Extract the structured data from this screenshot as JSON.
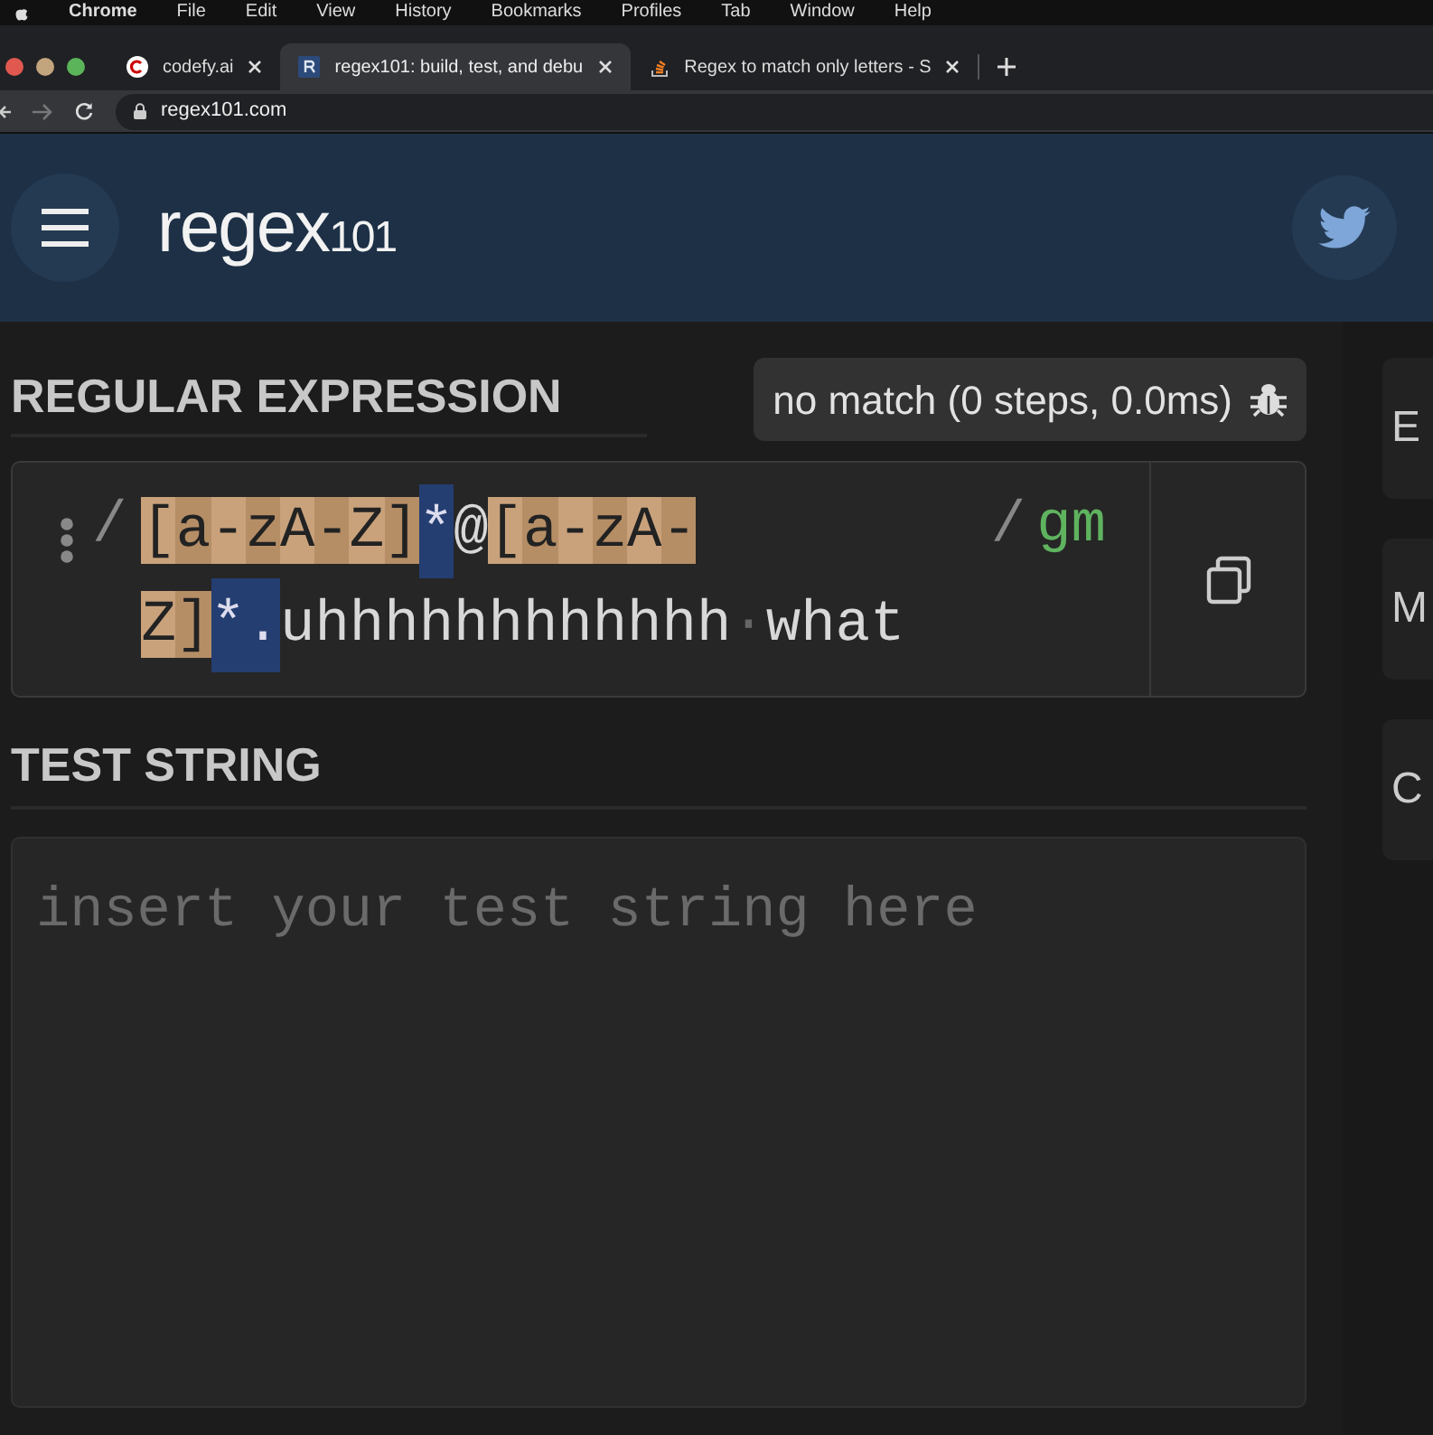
{
  "menu_bar": {
    "app": "Chrome",
    "items": [
      "File",
      "Edit",
      "View",
      "History",
      "Bookmarks",
      "Profiles",
      "Tab",
      "Window",
      "Help"
    ]
  },
  "browser_tabs": [
    {
      "title": "codefy.ai",
      "selected": false,
      "kind": "codefy"
    },
    {
      "title": "regex101: build, test, and debu",
      "selected": true,
      "kind": "regex"
    },
    {
      "title": "Regex to match only letters - S",
      "selected": false,
      "kind": "stack"
    }
  ],
  "address_bar": {
    "url": "regex101.com"
  },
  "header": {
    "logo_main": "regex",
    "logo_sub": "101"
  },
  "regex_section": {
    "title": "REGULAR EXPRESSION",
    "status": "no match (0 steps, 0.0ms)",
    "delimiter_open": "/",
    "delimiter_close": "/",
    "flags": "gm",
    "lines": [
      [
        {
          "kind": "class",
          "text": "[a-zA-Z]"
        },
        {
          "kind": "quant",
          "text": "*"
        },
        {
          "kind": "plain",
          "text": "@"
        },
        {
          "kind": "class",
          "text": "[a-zA-"
        }
      ],
      [
        {
          "kind": "class",
          "text": "Z]"
        },
        {
          "kind": "quant",
          "text": "*."
        },
        {
          "kind": "plain",
          "text": "uhhhhhhhhhhhh"
        },
        {
          "kind": "space",
          "text": "·"
        },
        {
          "kind": "plain",
          "text": "what"
        }
      ]
    ]
  },
  "test_section": {
    "title": "TEST STRING",
    "placeholder": "insert your test string here"
  },
  "sidebar": {
    "cards": [
      "E",
      "M",
      "C"
    ]
  }
}
